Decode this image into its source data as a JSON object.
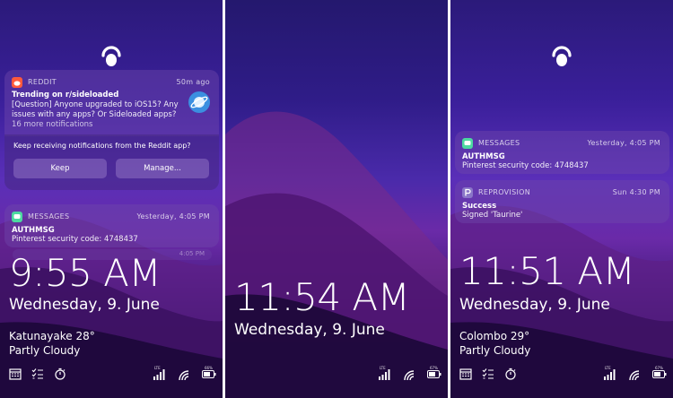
{
  "panel1": {
    "reddit": {
      "app": "REDDIT",
      "time": "50m ago",
      "title": "Trending on r/sideloaded",
      "body_line1": "[Question] Anyone upgraded to iOS15? Any",
      "body_line2": "issues with any apps? Or Sideloaded apps?",
      "more": "16 more notifications",
      "question": "Keep receiving notifications from the Reddit app?",
      "keep_label": "Keep",
      "manage_label": "Manage..."
    },
    "messages": {
      "app": "MESSAGES",
      "time": "Yesterday, 4:05 PM",
      "title": "AUTHMSG",
      "body": "Pinterest security code: 4748437"
    },
    "ghost_time": "4:05 PM",
    "clock": "9:55 AM",
    "date": "Wednesday, 9. June",
    "weather_location": "Katunayake 28°",
    "weather_condition": "Partly Cloudy",
    "status_lte": "LTE",
    "status_battery": "66%"
  },
  "panel2": {
    "clock": "11:54 AM",
    "date": "Wednesday, 9. June",
    "status_lte": "LTE",
    "status_battery": "67%"
  },
  "panel3": {
    "messages": {
      "app": "MESSAGES",
      "time": "Yesterday, 4:05 PM",
      "title": "AUTHMSG",
      "body": "Pinterest security code: 4748437"
    },
    "reprovision": {
      "app": "REPROVISION",
      "time": "Sun 4:30 PM",
      "title": "Success",
      "body": "Signed 'Taurine'"
    },
    "clock": "11:51 AM",
    "date": "Wednesday, 9. June",
    "weather_location": "Colombo 29°",
    "weather_condition": "Partly Cloudy",
    "status_lte": "LTE",
    "status_battery": "67%"
  },
  "colors": {
    "reddit_orange": "#ff5a3c",
    "messages_green": "#4cd9a0",
    "reprovision_purple": "#8a76c8"
  },
  "icons": [
    "lock-icon",
    "calendar-icon",
    "checklist-icon",
    "timer-icon",
    "signal-icon",
    "wifi-icon",
    "battery-icon"
  ]
}
